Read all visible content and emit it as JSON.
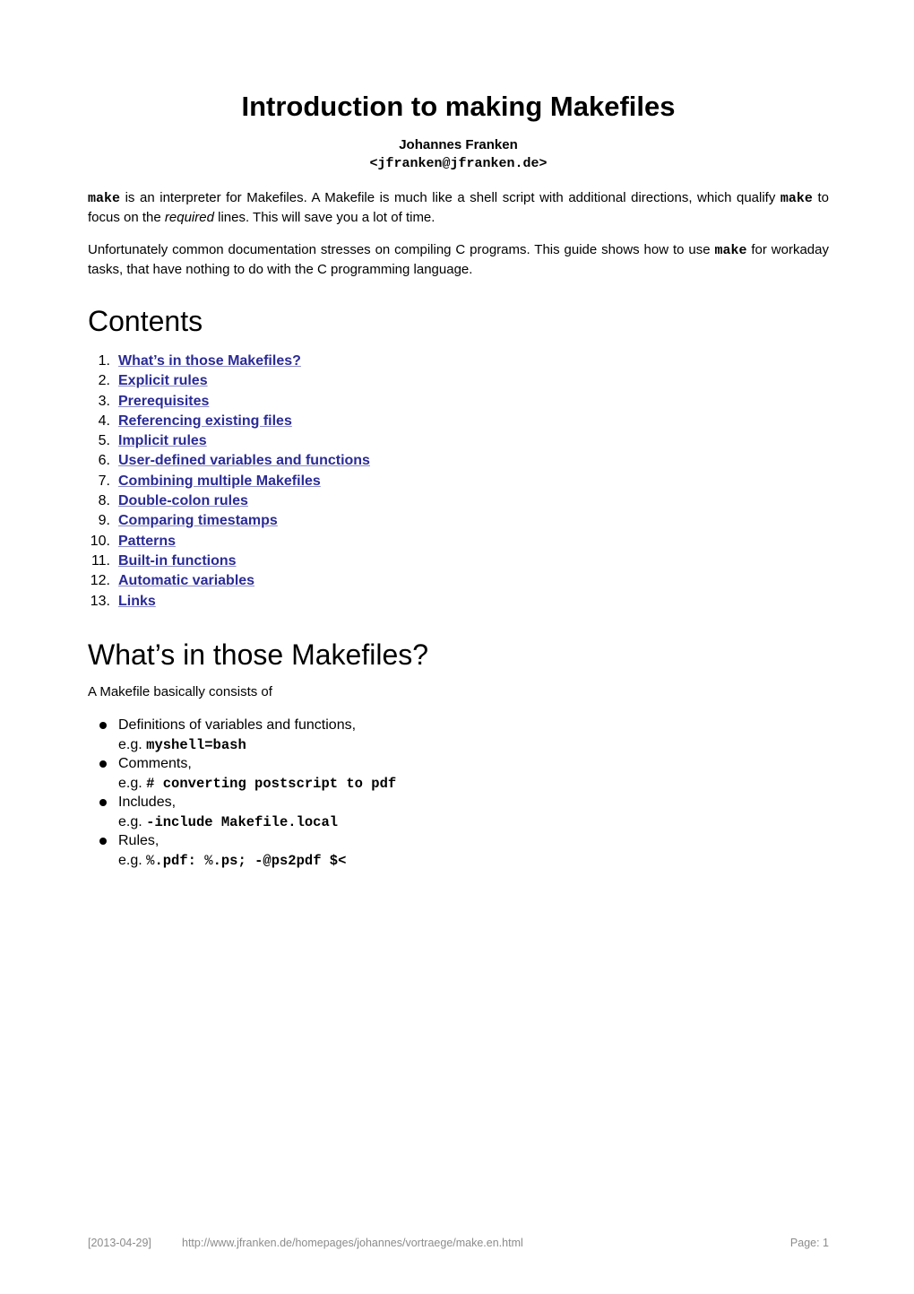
{
  "document": {
    "title": "Introduction to making Makefiles",
    "author": "Johannes Franken",
    "email": "<jfranken@jfranken.de>"
  },
  "intro": {
    "p1": {
      "code1": "make",
      "text1": " is an interpreter for Makefiles. A Makefile is much like a shell script with additional directions, which qualify ",
      "code2": "make",
      "text2": " to focus on the ",
      "em": "required",
      "text3": " lines. This will save you a lot of time."
    },
    "p2": {
      "text1": "Unfortunately common documentation stresses on compiling C programs. This guide shows how to use ",
      "code1": "make",
      "text2": " for workaday tasks, that have nothing to do with the C programming language."
    }
  },
  "contents": {
    "heading": "Contents",
    "items": [
      {
        "num": "1.",
        "label": "What’s in those Makefiles?"
      },
      {
        "num": "2.",
        "label": "Explicit rules"
      },
      {
        "num": "3.",
        "label": "Prerequisites"
      },
      {
        "num": "4.",
        "label": "Referencing existing files"
      },
      {
        "num": "5.",
        "label": "Implicit rules"
      },
      {
        "num": "6.",
        "label": "User-defined variables and functions"
      },
      {
        "num": "7.",
        "label": "Combining multiple Makefiles"
      },
      {
        "num": "8.",
        "label": "Double-colon rules"
      },
      {
        "num": "9.",
        "label": "Comparing timestamps"
      },
      {
        "num": "10.",
        "label": "Patterns"
      },
      {
        "num": "11.",
        "label": "Built-in functions"
      },
      {
        "num": "12.",
        "label": "Automatic variables"
      },
      {
        "num": "13.",
        "label": "Links"
      }
    ],
    "link_color": "#2a2a96"
  },
  "section1": {
    "heading": "What’s in those Makefiles?",
    "lead": "A Makefile basically consists of",
    "eg_prefix": "e.g. ",
    "items": [
      {
        "text": "Definitions of variables and functions,",
        "example": "myshell=bash"
      },
      {
        "text": "Comments,",
        "example": "# converting postscript to pdf"
      },
      {
        "text": "Includes,",
        "example": "-include Makefile.local"
      },
      {
        "text": "Rules,",
        "example_parts": [
          "%",
          ".pdf: ",
          "%",
          ".ps; -@ps2pdf $<"
        ]
      }
    ]
  },
  "footer": {
    "date": "[2013-04-29]",
    "url": "http://www.jfranken.de/homepages/johannes/vortraege/make.en.html",
    "page": "Page: 1"
  }
}
